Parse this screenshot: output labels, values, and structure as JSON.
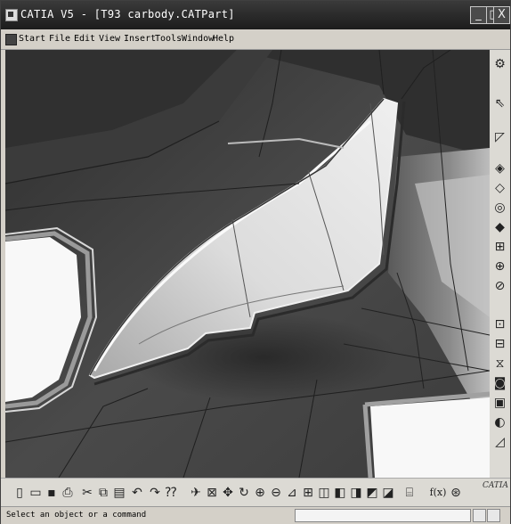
{
  "window": {
    "title": "CATIA V5 - [T93 carbody.CATPart]",
    "minimize_label": "_",
    "maximize_label": "□",
    "close_label": "X"
  },
  "menu": {
    "items": [
      {
        "label": "Start"
      },
      {
        "label": "File"
      },
      {
        "label": "Edit"
      },
      {
        "label": "View"
      },
      {
        "label": "Insert"
      },
      {
        "label": "Tools"
      },
      {
        "label": "Window"
      },
      {
        "label": "Help"
      }
    ]
  },
  "right_toolbar": {
    "icons": [
      "gear-icon",
      "select-arrow-icon",
      "sketcher-icon",
      "surface-icon",
      "extrude-icon",
      "revolve-icon",
      "sweep-icon",
      "blend-icon",
      "fill-icon",
      "offset-icon",
      "boolean-icon",
      "join-icon",
      "split-icon",
      "trim-icon",
      "extract-icon",
      "fillet-icon",
      "draft-icon"
    ]
  },
  "bottom_toolbar": {
    "formula_label": "f(x)",
    "icons": [
      "new-file-icon",
      "open-file-icon",
      "save-icon",
      "print-icon",
      "cut-icon",
      "copy-icon",
      "paste-icon",
      "undo-icon",
      "redo-icon",
      "help-pointer-icon",
      "fly-mode-icon",
      "fit-all-icon",
      "pan-icon",
      "rotate-icon",
      "zoom-in-icon",
      "zoom-out-icon",
      "normal-view-icon",
      "multi-view-icon",
      "isometric-view-icon",
      "hide-show-icon",
      "swap-space-icon",
      "render-style-icon",
      "material-icon",
      "measure-icon",
      "formula-icon",
      "knowledge-icon"
    ]
  },
  "logo": {
    "text": "CATIA"
  },
  "status": {
    "text": "Select an object or a command",
    "command_value": ""
  }
}
